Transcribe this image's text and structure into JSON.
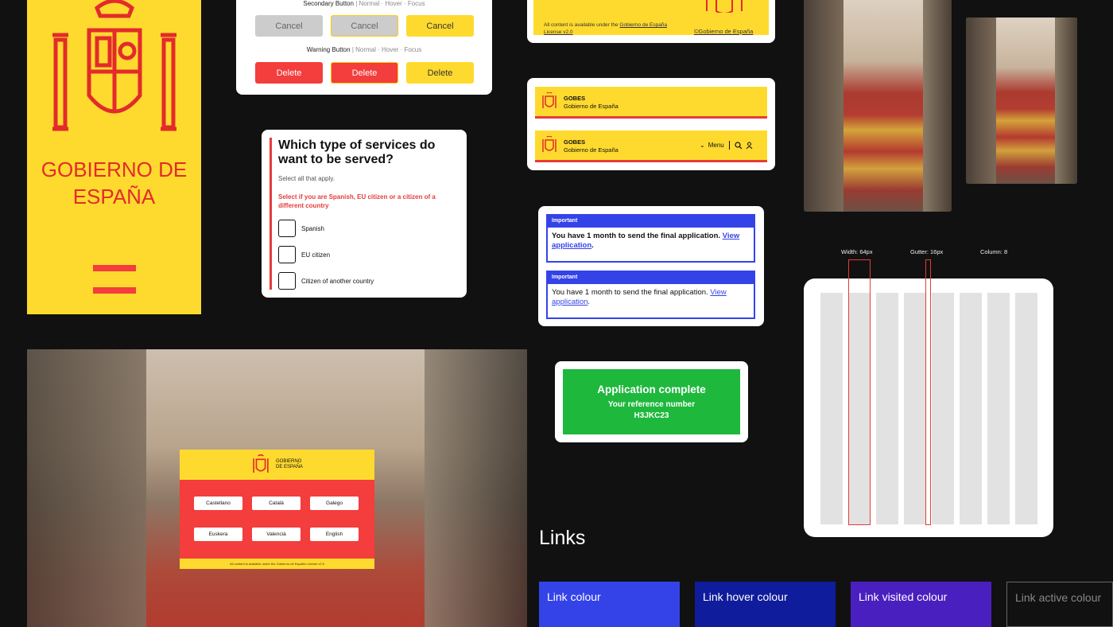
{
  "poster": {
    "title_line1": "GOBIERNO DE",
    "title_line2": "ESPAÑA"
  },
  "buttons": {
    "secondary_label": "Secondary Button",
    "warning_label": "Warning Button",
    "states": "| Normal · Hover · Focus",
    "cancel": "Cancel",
    "delete": "Delete"
  },
  "form": {
    "question": "Which type of services do want to be served?",
    "hint": "Select all that apply.",
    "error": "Select if you are Spanish, EU citizen or a citizen of a different country",
    "options": [
      "Spanish",
      "EU citizen",
      "Citizen of another country"
    ]
  },
  "footer_sample": {
    "license_prefix": "All content is available under the",
    "license_link": "Gobierno de España",
    "license_link2": "License v2.0",
    "copyright": "©Gobierno de España"
  },
  "header_sample": {
    "short_name": "GOBES",
    "full_name": "Gobierno de España",
    "menu": "Menu"
  },
  "notifications": {
    "heading": "Important",
    "text": "You have 1 month to send the final application.",
    "link_line1": "View",
    "link_line2": "application"
  },
  "success": {
    "title": "Application complete",
    "subtitle": "Your reference number",
    "reference": "H3JKC23"
  },
  "grid": {
    "width_label": "Width: 64px",
    "gutter_label": "Gutter: 16px",
    "columns_label": "Column: 8"
  },
  "language_selector": {
    "brand_line1": "GOBIERNO",
    "brand_line2": "DE ESPAÑA",
    "languages": [
      "Castellano",
      "Català",
      "Galego",
      "Euskera",
      "Valencià",
      "English"
    ],
    "footer": "All content is available under the Gobierno de España License v2.0"
  },
  "links": {
    "title": "Links",
    "swatches": [
      {
        "label": "Link colour",
        "color": "#3443e8"
      },
      {
        "label": "Link hover colour",
        "color": "#0f1c9b"
      },
      {
        "label": "Link visited colour",
        "color": "#4a1fbf"
      },
      {
        "label": "Link active colour",
        "color": "#111111"
      }
    ]
  },
  "colors": {
    "yellow": "#ffda2e",
    "red": "#f43d3d",
    "green": "#1eb83d",
    "blue": "#3443e8"
  }
}
